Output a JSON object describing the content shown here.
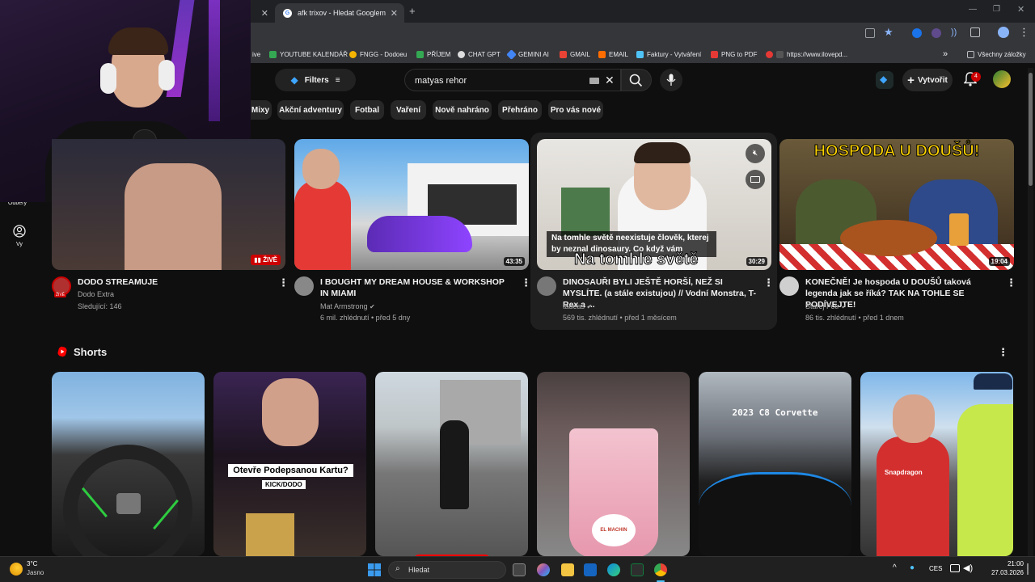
{
  "browser": {
    "tabs": [
      {
        "label": "afk trixov - Hledat Googlem"
      }
    ],
    "new_tab": "+",
    "bookmarks": [
      {
        "label": "ive"
      },
      {
        "label": "YOUTUBE KALENDÁŘ"
      },
      {
        "label": "FNGG - Dodoeu"
      },
      {
        "label": "PŘÍJEM"
      },
      {
        "label": "CHAT GPT"
      },
      {
        "label": "GEMINI AI"
      },
      {
        "label": "GMAIL"
      },
      {
        "label": "EMAIL"
      },
      {
        "label": "Faktury - Vytváření"
      },
      {
        "label": "PNG to PDF"
      },
      {
        "label": "https://www.ilovepd..."
      }
    ],
    "more": "»",
    "all_bookmarks": "Všechny záložky"
  },
  "youtube": {
    "filters_label": "Filters",
    "search_value": "matyas rehor",
    "create_label": "Vytvořit",
    "notif_count": "4",
    "sidebar": [
      {
        "label": "Odběry"
      },
      {
        "label": "Vy"
      }
    ],
    "chips": [
      "Mixy",
      "Akční adventury",
      "Fotbal",
      "Vaření",
      "Nově nahráno",
      "Přehráno",
      "Pro vás nové"
    ],
    "videos": [
      {
        "title": "DODO STREAMUJE",
        "channel": "Dodo Extra",
        "stats": "Sledující: 146",
        "badge": "ŽIVĚ",
        "avatar_badge": "ŽIVĚ"
      },
      {
        "title": "I BOUGHT MY DREAM HOUSE & WORKSHOP IN MIAMI",
        "channel": "Mat Armstrong",
        "stats": "6 mil. zhlédnutí • před 5 dny",
        "duration": "43:35"
      },
      {
        "title": "DINOSAUŘI BYLI JEŠTĚ HORŠÍ, NEŽ SI MYSLÍTE. (a stále existujou) // Vodní Monstra, T-Rex a ...",
        "channel": "tadeas",
        "stats": "569 tis. zhlédnutí • před 1 měsícem",
        "duration": "30:29",
        "caption": "Na tomhle světě neexistuje člověk, kterej by neznal dinosaury. Co když vám",
        "overlay_text": "Na tomhle světě"
      },
      {
        "title": "KONEČNĚ! Je hospoda U DOUŠŮ taková legenda jak se říká? TAK NA TOHLE SE PODÍVEJTE!",
        "channel": "Starej Fotr",
        "stats": "86 tis. zhlédnutí • před 1 dnem",
        "duration": "19:04",
        "thumb_text": "HOSPODA U DOUŠŮ!"
      }
    ],
    "shorts_label": "Shorts",
    "shorts": [
      {
        "overlay": ""
      },
      {
        "overlay": "Otevře Podepsanou Kartu?",
        "sub": "KICK/DODO"
      },
      {
        "overlay": ""
      },
      {
        "overlay": "",
        "sub": "EL MACHIN"
      },
      {
        "overlay": "2023 C8 Corvette"
      },
      {
        "overlay": "",
        "sub": "Snapdragon"
      }
    ]
  },
  "taskbar": {
    "weather_temp": "3°C",
    "weather_text": "Jasno",
    "search_placeholder": "Hledat",
    "lang": "CES",
    "time": "21:00",
    "date": "27.03.2026"
  },
  "colors": {
    "yt_red": "#ff0000",
    "bg": "#0f0f0f",
    "chip": "#272727",
    "accent_blue": "#3ea6ff"
  }
}
